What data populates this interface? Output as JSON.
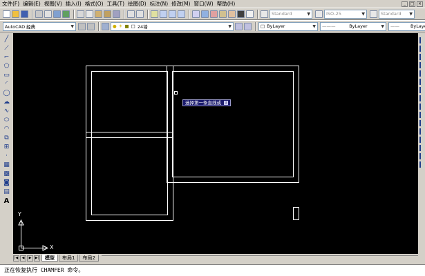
{
  "menu": [
    "文件(F)",
    "编辑(E)",
    "视图(V)",
    "插入(I)",
    "格式(O)",
    "工具(T)",
    "绘图(D)",
    "标注(N)",
    "修改(M)",
    "窗口(W)",
    "帮助(H)"
  ],
  "toolbar": {
    "text_style": "Standard",
    "dim_style": "ISO-25",
    "table_style": "Standard"
  },
  "workspace": {
    "name": "AutoCAD 经典",
    "layer": "24墙"
  },
  "properties": {
    "color": "ByLayer",
    "linetype": "ByLayer",
    "lineweight": "ByLayer"
  },
  "prompt_tooltip": "选择第一条直线或",
  "ucs": {
    "x_label": "X",
    "y_label": "Y"
  },
  "tabs": [
    "模型",
    "布局1",
    "布局2"
  ],
  "command_line": "正在恢复执行 CHAMFER 命令。",
  "colors": {
    "canvas": "#000000",
    "geometry": "#ffffff",
    "tooltip_bg": "#1c1c6e",
    "chrome": "#d4d0c8"
  }
}
